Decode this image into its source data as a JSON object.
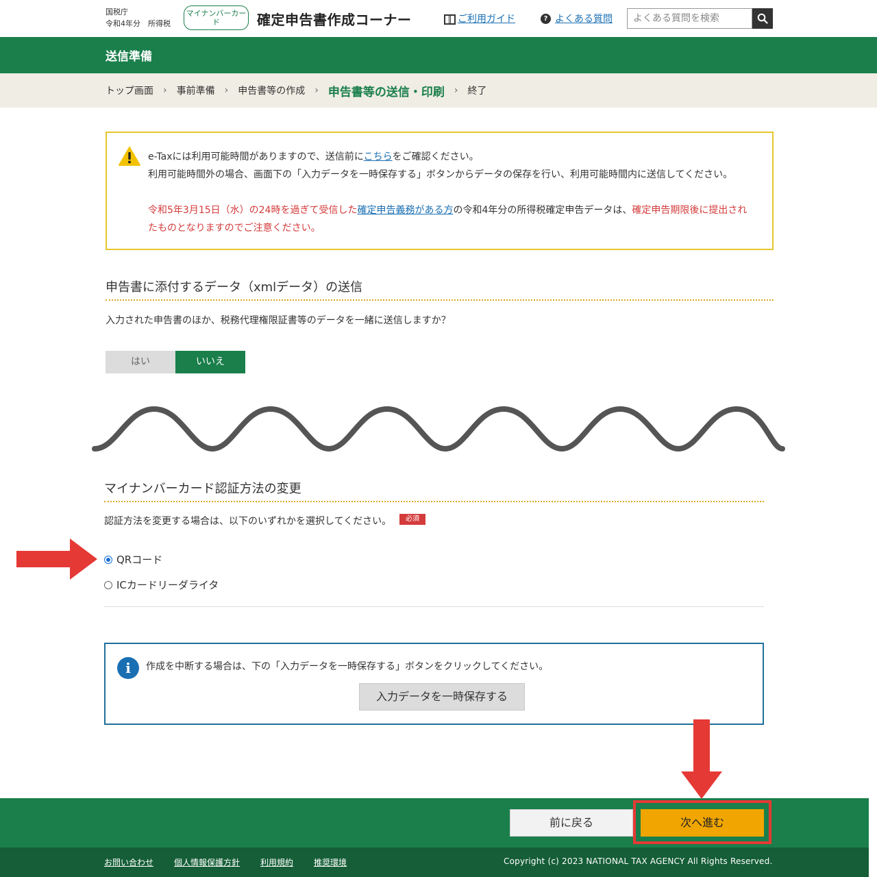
{
  "header": {
    "agency_line1": "国税庁",
    "agency_line2": "令和4年分　所得税",
    "card_badge": "マイナンバーカード",
    "site_title": "確定申告書作成コーナー",
    "guide_label": "ご利用ガイド",
    "faq_label": "よくある質問",
    "search_placeholder": "よくある質問を検索"
  },
  "page_band": {
    "title": "送信準備"
  },
  "breadcrumb": [
    "トップ画面",
    "事前準備",
    "申告書等の作成",
    "申告書等の送信・印刷",
    "終了"
  ],
  "breadcrumb_current": "申告書等の送信・印刷",
  "warning": {
    "line1_pre": "e-Taxには利用可能時間がありますので、送信前に",
    "line1_link": "こちら",
    "line1_post": "をご確認ください。",
    "line2": "利用可能時間外の場合、画面下の「入力データを一時保存する」ボタンからデータの保存を行い、利用可能時間内に送信してください。",
    "red_pre": "令和5年3月15日（水）の24時を過ぎて受信した",
    "red_link": "確定申告義務がある方",
    "red_mid": "の令和4年分の所得税確定申告データは、",
    "red_post": "確定申告期限後に提出されたものとなりますのでご注意ください。"
  },
  "section_attach": {
    "title": "申告書に添付するデータ（xmlデータ）の送信",
    "question": "入力された申告書のほか、税務代理権限証書等のデータを一緒に送信しますか？",
    "yes_label": "はい",
    "no_label": "いいえ",
    "selected": "いいえ"
  },
  "section_auth": {
    "title": "マイナンバーカード認証方法の変更",
    "instruction": "認証方法を変更する場合は、以下のいずれかを選択してください。",
    "required_badge": "必須",
    "options": [
      "QRコード",
      "ICカードリーダライタ"
    ],
    "selected": "QRコード"
  },
  "info_box": {
    "text": "作成を中断する場合は、下の「入力データを一時保存する」ボタンをクリックしてください。",
    "save_label": "入力データを一時保存する"
  },
  "actions": {
    "back_label": "前に戻る",
    "next_label": "次へ進む"
  },
  "footer": {
    "links": [
      "お問い合わせ",
      "個人情報保護方針",
      "利用規約",
      "推奨環境"
    ],
    "copyright": "Copyright (c) 2023 NATIONAL TAX AGENCY All Rights Reserved."
  },
  "colors": {
    "brand_green": "#1a7f4b",
    "accent_orange": "#f0a500",
    "annotation_red": "#e53935",
    "warning_border": "#e6c62c"
  }
}
